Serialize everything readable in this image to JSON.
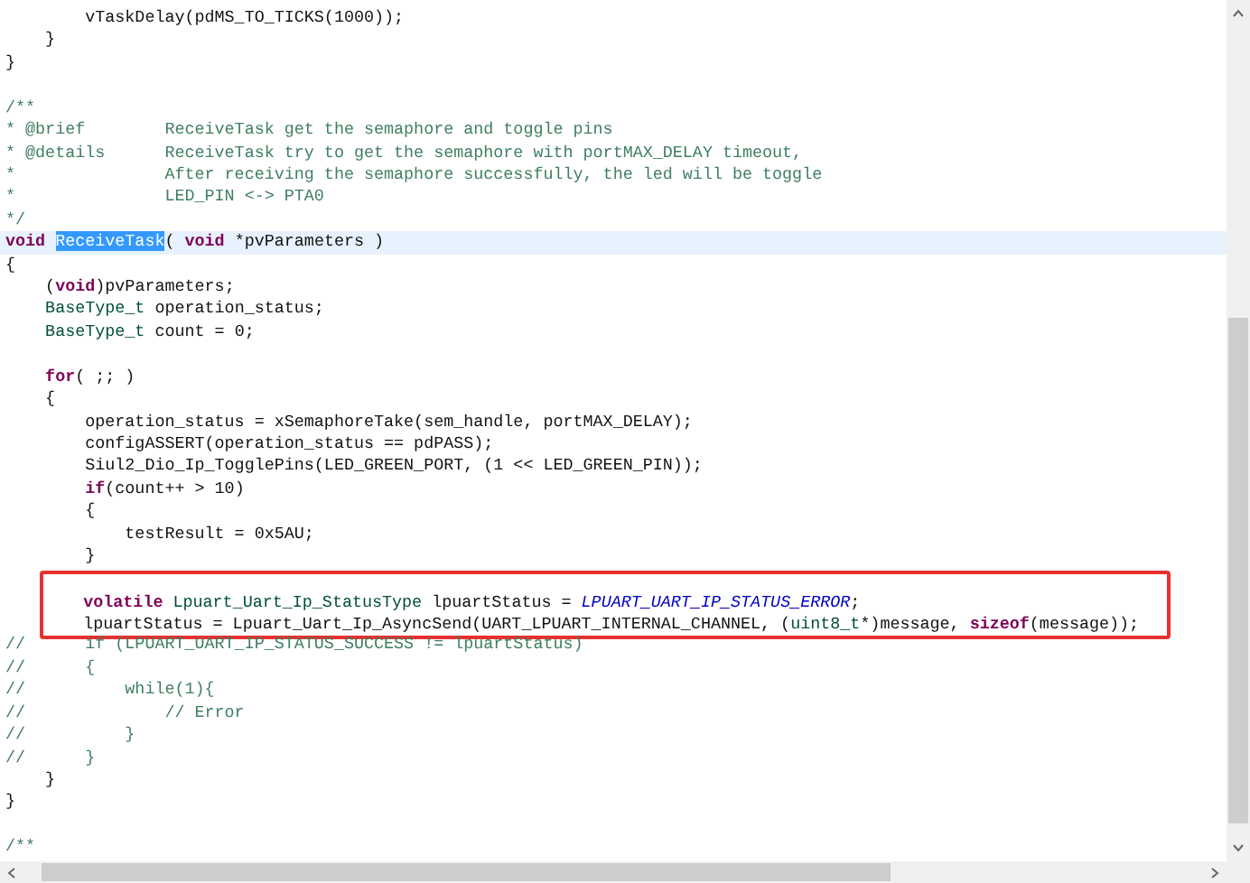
{
  "editor": {
    "lines": [
      {
        "kind": "code",
        "current": false,
        "boxed": false,
        "segments": [
          {
            "kind": "plain",
            "text": "        vTaskDelay(pdMS_TO_TICKS(1000));"
          }
        ]
      },
      {
        "kind": "code",
        "current": false,
        "boxed": false,
        "segments": [
          {
            "kind": "plain",
            "text": "    }"
          }
        ]
      },
      {
        "kind": "code",
        "current": false,
        "boxed": false,
        "segments": [
          {
            "kind": "plain",
            "text": "}"
          }
        ]
      },
      {
        "kind": "blank"
      },
      {
        "kind": "code",
        "current": false,
        "boxed": false,
        "segments": [
          {
            "kind": "doc",
            "text": "/**"
          }
        ]
      },
      {
        "kind": "code",
        "current": false,
        "boxed": false,
        "segments": [
          {
            "kind": "doc",
            "text": "* @brief        ReceiveTask get the semaphore and toggle pins"
          }
        ]
      },
      {
        "kind": "code",
        "current": false,
        "boxed": false,
        "segments": [
          {
            "kind": "doc",
            "text": "* @details      ReceiveTask try to get the semaphore with portMAX_DELAY timeout,"
          }
        ]
      },
      {
        "kind": "code",
        "current": false,
        "boxed": false,
        "segments": [
          {
            "kind": "doc",
            "text": "*               After receiving the semaphore successfully, the led will be toggle"
          }
        ]
      },
      {
        "kind": "code",
        "current": false,
        "boxed": false,
        "segments": [
          {
            "kind": "doc",
            "text": "*               LED_PIN <-> PTA0"
          }
        ]
      },
      {
        "kind": "code",
        "current": false,
        "boxed": false,
        "segments": [
          {
            "kind": "doc",
            "text": "*/"
          }
        ]
      },
      {
        "kind": "code",
        "current": true,
        "boxed": false,
        "segments": [
          {
            "kind": "keyword",
            "text": "void "
          },
          {
            "kind": "selected",
            "text": "ReceiveTask"
          },
          {
            "kind": "plain",
            "text": "( "
          },
          {
            "kind": "keyword",
            "text": "void"
          },
          {
            "kind": "plain",
            "text": " *pvParameters )"
          }
        ]
      },
      {
        "kind": "code",
        "current": false,
        "boxed": false,
        "segments": [
          {
            "kind": "plain",
            "text": "{"
          }
        ]
      },
      {
        "kind": "code",
        "current": false,
        "boxed": false,
        "segments": [
          {
            "kind": "plain",
            "text": "    ("
          },
          {
            "kind": "keyword",
            "text": "void"
          },
          {
            "kind": "plain",
            "text": ")pvParameters;"
          }
        ]
      },
      {
        "kind": "code",
        "current": false,
        "boxed": false,
        "segments": [
          {
            "kind": "type",
            "text": "    BaseType_t"
          },
          {
            "kind": "plain",
            "text": " operation_status;"
          }
        ]
      },
      {
        "kind": "code",
        "current": false,
        "boxed": false,
        "segments": [
          {
            "kind": "type",
            "text": "    BaseType_t"
          },
          {
            "kind": "plain",
            "text": " count = 0;"
          }
        ]
      },
      {
        "kind": "blank"
      },
      {
        "kind": "code",
        "current": false,
        "boxed": false,
        "segments": [
          {
            "kind": "keyword",
            "text": "    for"
          },
          {
            "kind": "plain",
            "text": "( ;; )"
          }
        ]
      },
      {
        "kind": "code",
        "current": false,
        "boxed": false,
        "segments": [
          {
            "kind": "plain",
            "text": "    {"
          }
        ]
      },
      {
        "kind": "code",
        "current": false,
        "boxed": false,
        "segments": [
          {
            "kind": "plain",
            "text": "        operation_status = xSemaphoreTake(sem_handle, portMAX_DELAY);"
          }
        ]
      },
      {
        "kind": "code",
        "current": false,
        "boxed": false,
        "segments": [
          {
            "kind": "plain",
            "text": "        configASSERT(operation_status == pdPASS);"
          }
        ]
      },
      {
        "kind": "code",
        "current": false,
        "boxed": false,
        "segments": [
          {
            "kind": "plain",
            "text": "        Siul2_Dio_Ip_TogglePins(LED_GREEN_PORT, (1 << LED_GREEN_PIN));"
          }
        ]
      },
      {
        "kind": "code",
        "current": false,
        "boxed": false,
        "segments": [
          {
            "kind": "keyword",
            "text": "        if"
          },
          {
            "kind": "plain",
            "text": "(count++ > 10)"
          }
        ]
      },
      {
        "kind": "code",
        "current": false,
        "boxed": false,
        "segments": [
          {
            "kind": "plain",
            "text": "        {"
          }
        ]
      },
      {
        "kind": "code",
        "current": false,
        "boxed": false,
        "segments": [
          {
            "kind": "plain",
            "text": "            testResult = 0x5AU;"
          }
        ]
      },
      {
        "kind": "code",
        "current": false,
        "boxed": false,
        "segments": [
          {
            "kind": "plain",
            "text": "        }"
          }
        ]
      },
      {
        "kind": "code",
        "current": false,
        "boxed": true,
        "segments": [
          {
            "kind": "keyword",
            "text": "        volatile "
          },
          {
            "kind": "type",
            "text": "Lpuart_Uart_Ip_StatusType"
          },
          {
            "kind": "plain",
            "text": " lpuartStatus = "
          },
          {
            "kind": "macro",
            "text": "LPUART_UART_IP_STATUS_ERROR"
          },
          {
            "kind": "plain",
            "text": ";"
          }
        ]
      },
      {
        "kind": "code",
        "current": false,
        "boxed": true,
        "segments": [
          {
            "kind": "plain",
            "text": "        lpuartStatus = Lpuart_Uart_Ip_AsyncSend(UART_LPUART_INTERNAL_CHANNEL, ("
          },
          {
            "kind": "type",
            "text": "uint8_t"
          },
          {
            "kind": "plain",
            "text": "*)message, "
          },
          {
            "kind": "keyword",
            "text": "sizeof"
          },
          {
            "kind": "plain",
            "text": "(message));"
          }
        ]
      },
      {
        "kind": "code",
        "current": false,
        "boxed": false,
        "segments": [
          {
            "kind": "comment",
            "text": "//      if (LPUART_UART_IP_STATUS_SUCCESS != lpuartStatus)"
          }
        ]
      },
      {
        "kind": "code",
        "current": false,
        "boxed": false,
        "segments": [
          {
            "kind": "comment",
            "text": "//      {"
          }
        ]
      },
      {
        "kind": "code",
        "current": false,
        "boxed": false,
        "segments": [
          {
            "kind": "comment",
            "text": "//          while(1){"
          }
        ]
      },
      {
        "kind": "code",
        "current": false,
        "boxed": false,
        "segments": [
          {
            "kind": "comment",
            "text": "//              // Error"
          }
        ]
      },
      {
        "kind": "code",
        "current": false,
        "boxed": false,
        "segments": [
          {
            "kind": "comment",
            "text": "//          }"
          }
        ]
      },
      {
        "kind": "code",
        "current": false,
        "boxed": false,
        "segments": [
          {
            "kind": "comment",
            "text": "//      }"
          }
        ]
      },
      {
        "kind": "code",
        "current": false,
        "boxed": false,
        "segments": [
          {
            "kind": "plain",
            "text": "    }"
          }
        ]
      },
      {
        "kind": "code",
        "current": false,
        "boxed": false,
        "segments": [
          {
            "kind": "plain",
            "text": "}"
          }
        ]
      },
      {
        "kind": "blank"
      },
      {
        "kind": "code",
        "current": false,
        "boxed": false,
        "segments": [
          {
            "kind": "doc",
            "text": "/**"
          }
        ]
      }
    ]
  }
}
